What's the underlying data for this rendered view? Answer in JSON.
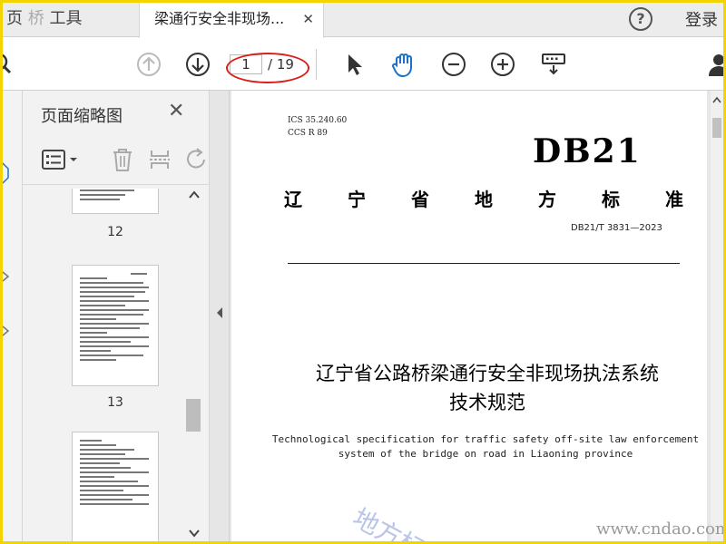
{
  "tabs": {
    "home_label": "页",
    "home_watermark": "桥",
    "tools_label": "工具",
    "doc_tab_label": "梁通行安全非现场...",
    "close_symbol": "✕"
  },
  "header": {
    "help_symbol": "?",
    "login_label": "登录"
  },
  "toolbar": {
    "current_page": "1",
    "total_pages": "/ 19"
  },
  "sidebar": {
    "title": "页面缩略图",
    "close_symbol": "✕",
    "thumbnails": [
      {
        "label": "12"
      },
      {
        "label": "13"
      }
    ]
  },
  "document": {
    "ics": "ICS  35.240.60",
    "ccs": "CCS  R 89",
    "db_mark": "DB21",
    "standard_chars": [
      "辽",
      "宁",
      "省",
      "地",
      "方",
      "标",
      "准"
    ],
    "number": "DB21/T 3831—2023",
    "title_line1": "辽宁省公路桥梁通行安全非现场执法系统",
    "title_line2": "技术规范",
    "en_line1": "Technological specification for traffic safety off-site law enforcement",
    "en_line2": "system of the bridge on road in Liaoning province",
    "watermark": "地方标"
  },
  "site_watermark": "www.cndao.com",
  "colors": {
    "accent_blue": "#1a73c8",
    "highlight_red": "#d9201c",
    "frame_yellow": "#f4d400"
  }
}
